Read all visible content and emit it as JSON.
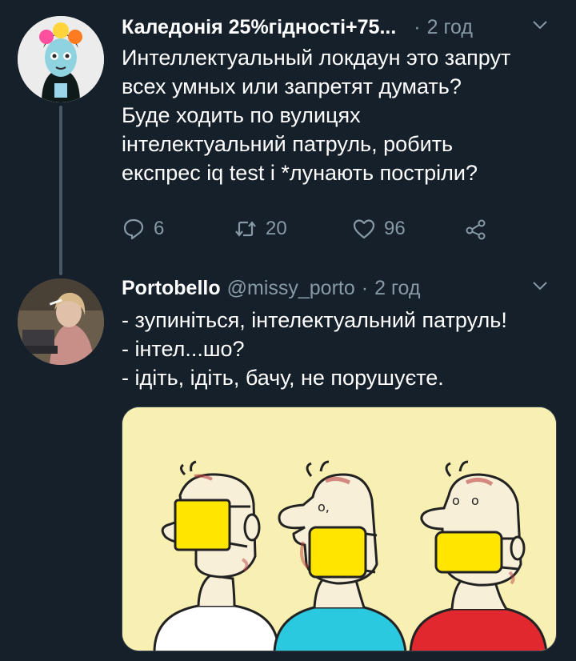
{
  "tweets": [
    {
      "author_name": "Каледонія 25%гідності+75...",
      "handle": "",
      "separator": "·",
      "time": "2 год",
      "lines": [
        "Интеллектуальный локдаун это запрут",
        "всех умных или запретят думать?",
        "Буде ходить по вулицях",
        "інтелектуальний патруль, робить",
        "експрес iq test і *лунають постріли?"
      ],
      "replies": "6",
      "retweets": "20",
      "likes": "96"
    },
    {
      "author_name": "Portobello",
      "handle": "@missy_porto",
      "separator": "·",
      "time": "2 год",
      "lines": [
        "- зупиніться, інтелектуальний патруль!",
        "- інтел...шо?",
        "- ідіть, ідіть, бачу, не порушуєте."
      ]
    }
  ],
  "icons": {
    "reply": "reply-icon",
    "retweet": "retweet-icon",
    "like": "heart-icon",
    "share": "share-icon",
    "caret": "chevron-down-icon"
  },
  "colors": {
    "background": "#15202b",
    "secondary_text": "#8899a6",
    "cartoon_bg": "#f8f0b2",
    "mask_yellow": "#ffe600",
    "shirt_cyan": "#2bc9e0",
    "shirt_red": "#e0282e"
  }
}
